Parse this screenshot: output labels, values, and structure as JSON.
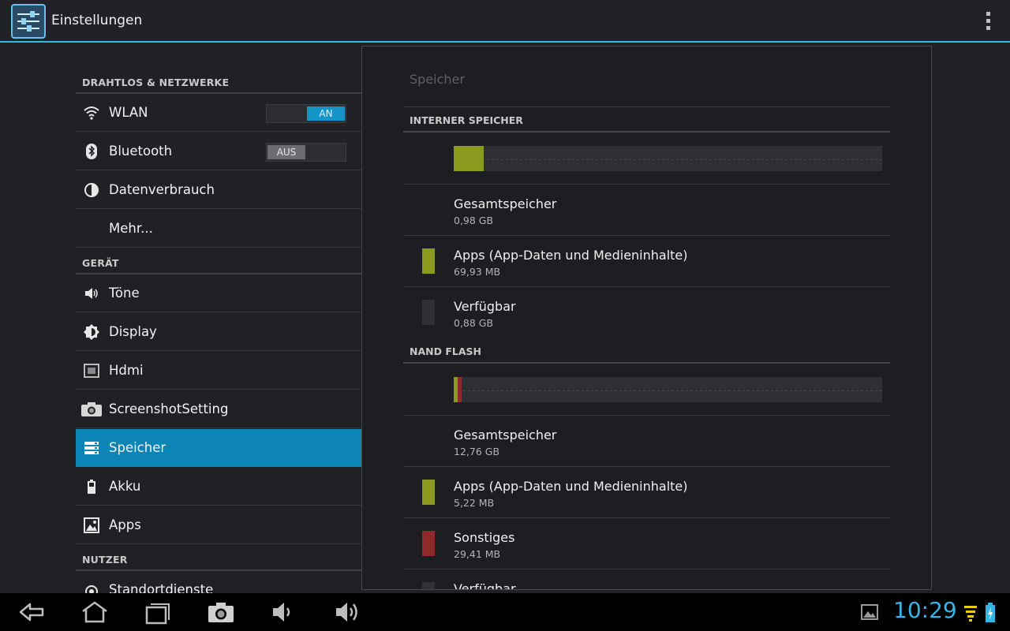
{
  "app": {
    "title": "Einstellungen"
  },
  "left": {
    "sections": [
      {
        "header": "DRAHTLOS & NETZWERKE",
        "items": [
          {
            "label": "WLAN",
            "icon": "wifi-icon",
            "toggle": "AN"
          },
          {
            "label": "Bluetooth",
            "icon": "bluetooth-icon",
            "toggle": "AUS"
          },
          {
            "label": "Datenverbrauch",
            "icon": "data-usage-icon"
          },
          {
            "label": "Mehr..."
          }
        ]
      },
      {
        "header": "GERÄT",
        "items": [
          {
            "label": "Töne",
            "icon": "speaker-icon"
          },
          {
            "label": "Display",
            "icon": "brightness-icon"
          },
          {
            "label": "Hdmi",
            "icon": "hdmi-icon"
          },
          {
            "label": "ScreenshotSetting",
            "icon": "camera-icon"
          },
          {
            "label": "Speicher",
            "icon": "storage-icon",
            "selected": true
          },
          {
            "label": "Akku",
            "icon": "battery-icon"
          },
          {
            "label": "Apps",
            "icon": "apps-icon"
          }
        ]
      },
      {
        "header": "NUTZER",
        "items": [
          {
            "label": "Standortdienste",
            "icon": "location-icon"
          }
        ]
      }
    ]
  },
  "panel": {
    "title": "Speicher",
    "internal": {
      "header": "INTERNER SPEICHER",
      "usage_fraction": {
        "apps": 0.07
      },
      "rows": [
        {
          "title": "Gesamtspeicher",
          "value": "0,98 GB"
        },
        {
          "title": "Apps (App-Daten und Medieninhalte)",
          "value": "69,93 MB",
          "color": "#8a9a1e"
        },
        {
          "title": "Verfügbar",
          "value": "0,88 GB",
          "color": "#2f3135"
        }
      ]
    },
    "nand": {
      "header": "NAND FLASH",
      "usage_fraction": {
        "apps": 0.01,
        "other": 0.01
      },
      "rows": [
        {
          "title": "Gesamtspeicher",
          "value": "12,76 GB"
        },
        {
          "title": "Apps (App-Daten und Medieninhalte)",
          "value": "5,22 MB",
          "color": "#8a9a1e"
        },
        {
          "title": "Sonstiges",
          "value": "29,41 MB",
          "color": "#8e2a2a"
        },
        {
          "title": "Verfügbar",
          "value": "",
          "color": "#2f3135"
        }
      ]
    }
  },
  "navbar": {
    "clock": "10:29"
  },
  "colors": {
    "accent": "#33b5e5",
    "apps": "#8a9a1e",
    "other": "#8e2a2a",
    "selected": "#0c85b6"
  }
}
